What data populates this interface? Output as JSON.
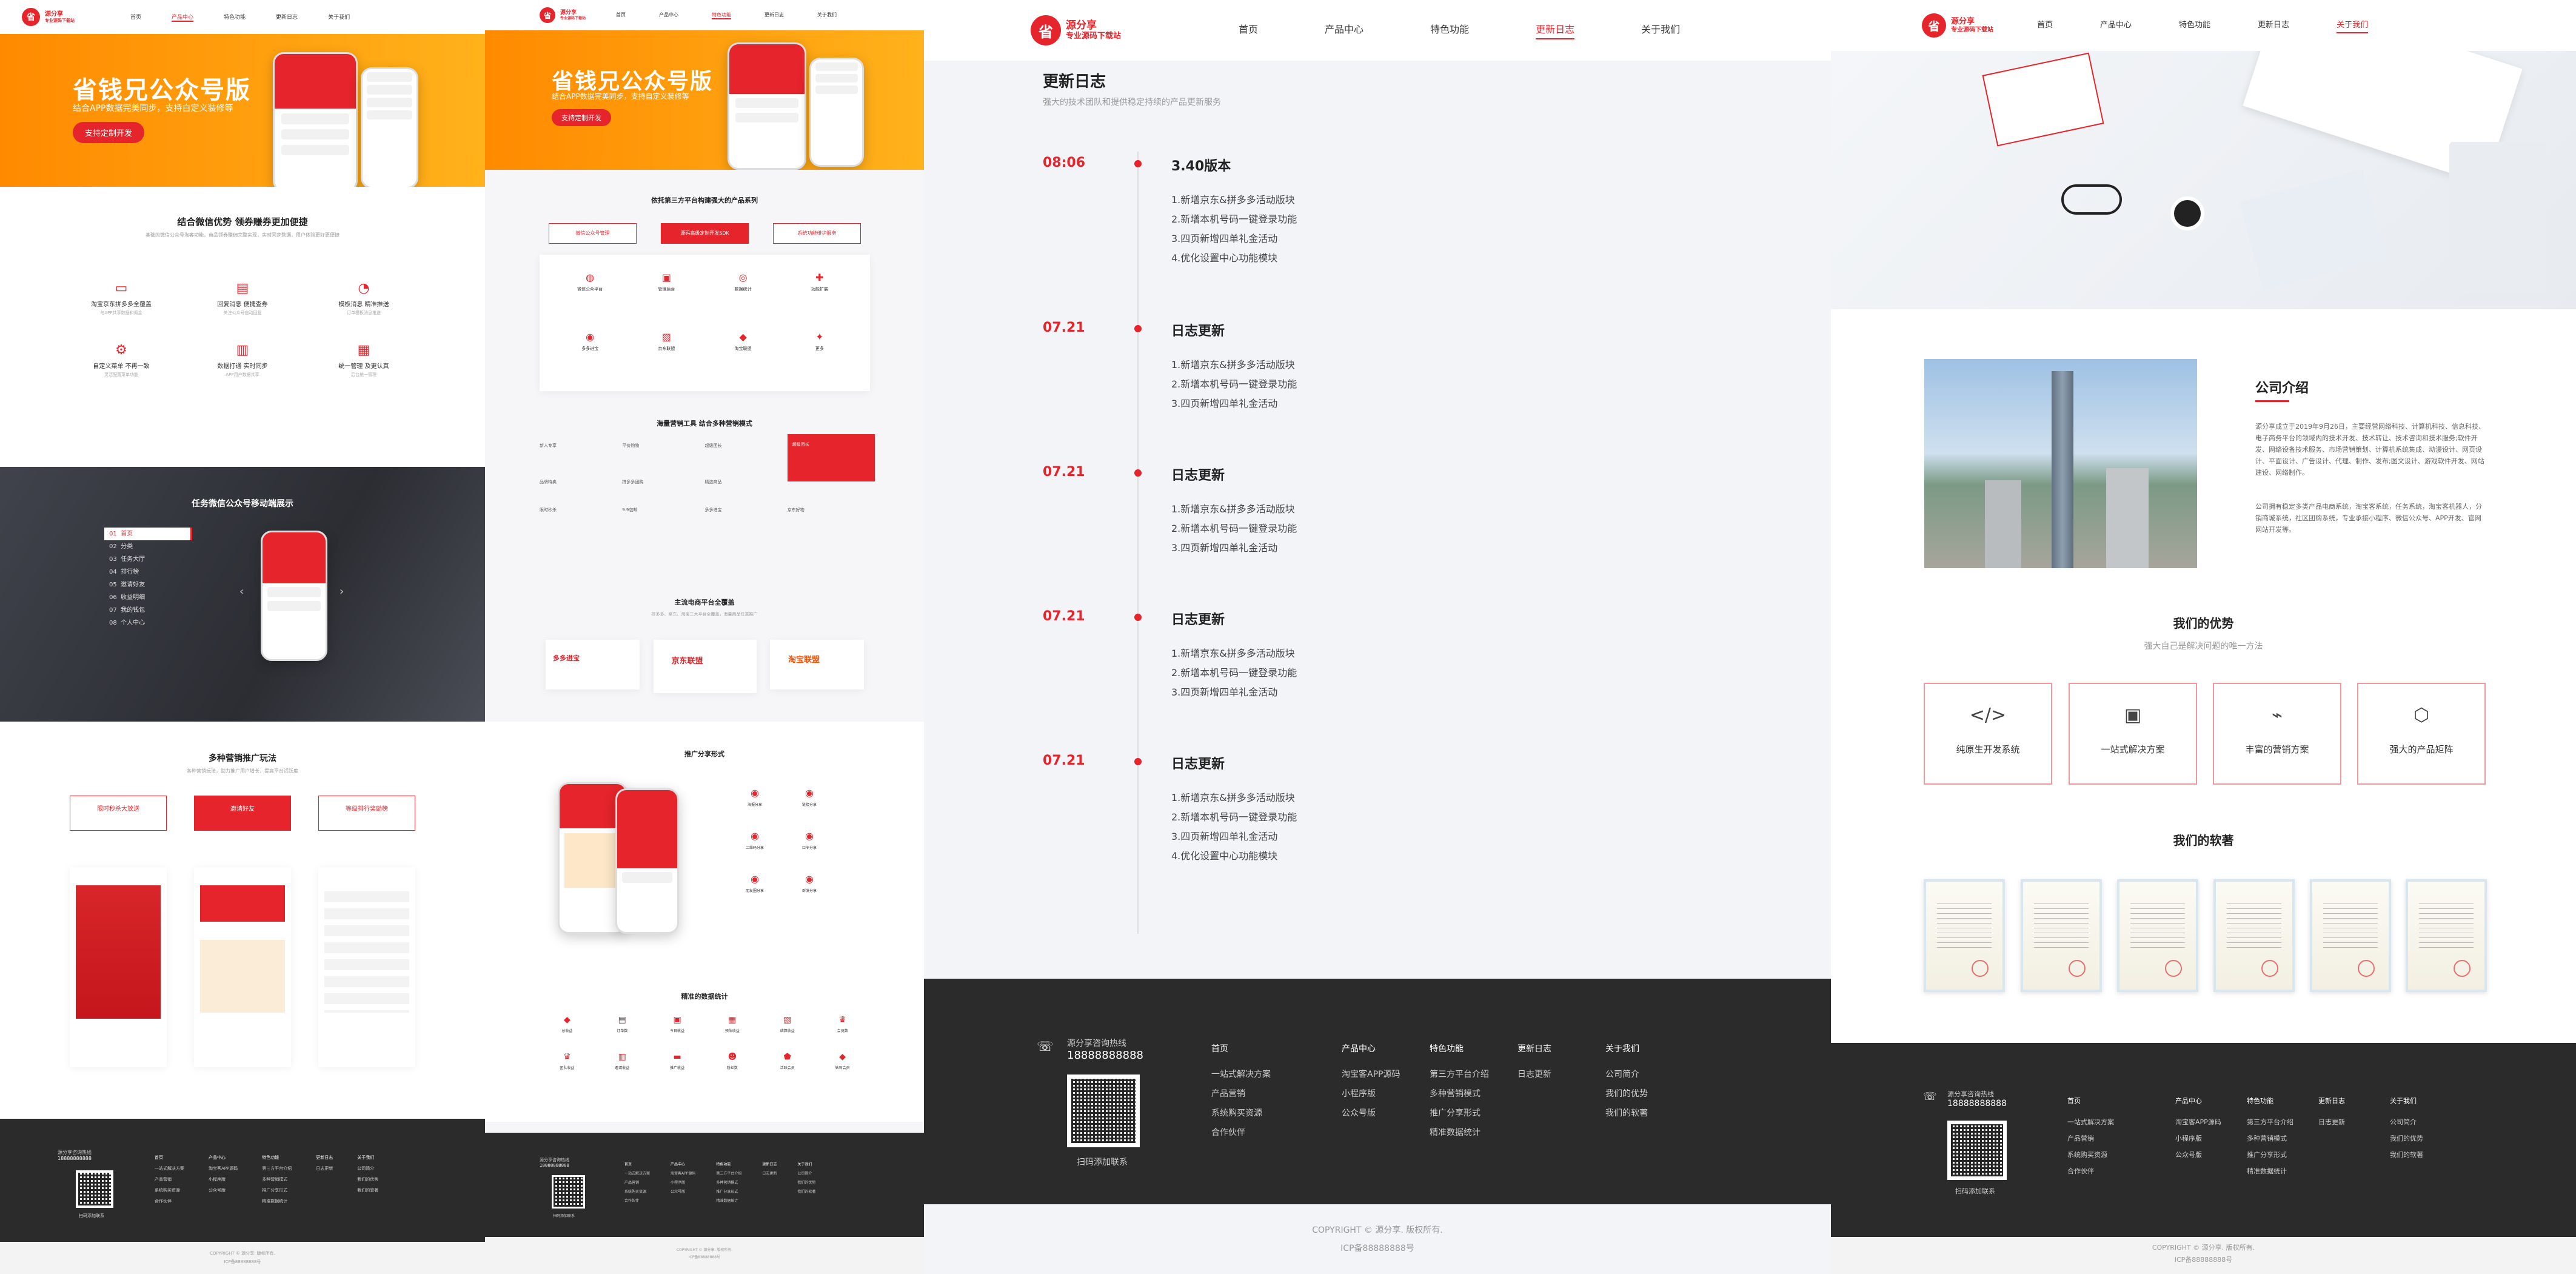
{
  "brand": {
    "mark": "省",
    "name": "源分享",
    "tagline": "专业源码下载站"
  },
  "nav": [
    "首页",
    "产品中心",
    "特色功能",
    "更新日志",
    "关于我们"
  ],
  "p1": {
    "banner": {
      "title": "省钱兄公众号版",
      "sub": "结合APP数据完美同步，支持自定义装修等",
      "btn": "支持定制开发"
    },
    "sec1": {
      "title": "结合微信优势 领券赚券更加便捷",
      "desc": "基础的微信公众号淘客功能，商品领券赚佣完整实现，实时同步数据，用户体验更好更便捷",
      "features": [
        {
          "icon": "▭",
          "t": "淘宝京东拼多多全覆盖",
          "d": "与APP共享数据和佣金"
        },
        {
          "icon": "▤",
          "t": "回复消息 便捷查券",
          "d": "关注公众号自动回复"
        },
        {
          "icon": "◔",
          "t": "模板消息 精准推送",
          "d": "订单模板消息推送"
        },
        {
          "icon": "⚙",
          "t": "自定义菜单 不再一致",
          "d": "灵活配置菜单功能"
        },
        {
          "icon": "▥",
          "t": "数据打通 实时同步",
          "d": "APP用户数据共享"
        },
        {
          "icon": "▦",
          "t": "统一管理 及更认真",
          "d": "后台统一管理"
        }
      ]
    },
    "sec2": {
      "title": "任务微信公众号移动端展示",
      "menu": [
        {
          "n": "01",
          "t": "首页"
        },
        {
          "n": "02",
          "t": "分类"
        },
        {
          "n": "03",
          "t": "任务大厅"
        },
        {
          "n": "04",
          "t": "排行榜"
        },
        {
          "n": "05",
          "t": "邀请好友"
        },
        {
          "n": "06",
          "t": "收益明细"
        },
        {
          "n": "07",
          "t": "我的钱包"
        },
        {
          "n": "08",
          "t": "个人中心"
        }
      ]
    },
    "sec3": {
      "title": "多种营销推广玩法",
      "desc": "各种营销玩法，助力推广用户增长，提高平台活跃度",
      "tabs": [
        "限时秒杀大放送",
        "邀请好友",
        "等级排行奖励榜"
      ]
    },
    "footer": {
      "hotline": "源分享咨询热线",
      "phone": "18888888888",
      "qr": "扫码添加联系",
      "cols": [
        {
          "h": "首页",
          "items": [
            "一站式解决方案",
            "产品营销",
            "系统购买资源",
            "合作伙伴"
          ]
        },
        {
          "h": "产品中心",
          "items": [
            "淘宝客APP源码",
            "小程序版",
            "公众号版"
          ]
        },
        {
          "h": "特色功能",
          "items": [
            "第三方平台介绍",
            "多种营销模式",
            "推广分享形式",
            "精准数据统计"
          ]
        },
        {
          "h": "更新日志",
          "items": [
            "日志更新"
          ]
        },
        {
          "h": "关于我们",
          "items": [
            "公司简介",
            "我们的优势",
            "我们的软著"
          ]
        }
      ]
    },
    "copyright": [
      "COPYRIGHT © 源分享. 版权所有.",
      "ICP备88888888号"
    ]
  },
  "p2": {
    "sec1": {
      "title": "依托第三方平台构建强大的产品系列",
      "tabs": [
        "微信公众号管理",
        "源码高级定制开发SDK",
        "系统功能维护服务"
      ],
      "icons": [
        {
          "icon": "◍",
          "t": "微信公众平台"
        },
        {
          "icon": "▣",
          "t": "管理后台"
        },
        {
          "icon": "◎",
          "t": "数据统计"
        },
        {
          "icon": "✚",
          "t": "功能扩展"
        },
        {
          "icon": "◉",
          "t": "多多进宝"
        },
        {
          "icon": "▧",
          "t": "京东联盟"
        },
        {
          "icon": "◆",
          "t": "淘宝联盟"
        },
        {
          "icon": "✦",
          "t": "更多"
        }
      ]
    },
    "sec2": {
      "title": "海量营销工具 结合多种营销模式",
      "cells": [
        "新人专享",
        "平价购物",
        "超级团长",
        "商品优惠券",
        "品牌特卖",
        "拼多多团购",
        "精选商品",
        "爆款专场",
        "限时秒杀",
        "9.9包邮",
        "多多进宝",
        "京东好物"
      ],
      "highlight": "超级团长"
    },
    "sec3": {
      "title": "主流电商平台全覆盖",
      "desc": "拼多多、京东、淘宝三大平台全覆盖，海量商品任意推广",
      "platforms": [
        {
          "t": "多多进宝",
          "c": "#e5242b"
        },
        {
          "t": "京东联盟",
          "c": "#e5242b"
        },
        {
          "t": "淘宝联盟",
          "c": "#ff5000"
        }
      ]
    },
    "sec4": {
      "title": "推广分享形式",
      "items": [
        "海报分享",
        "链接分享",
        "二维码分享",
        "口令分享",
        "朋友圈分享",
        "群发分享"
      ]
    },
    "sec5": {
      "title": "精准的数据统计",
      "items": [
        "总收益",
        "订单数",
        "今日收益",
        "预估收益",
        "结算收益",
        "会员数",
        "团队收益",
        "邀请收益",
        "推广收益",
        "粉丝数",
        "活跃会员",
        "钻石会员"
      ]
    },
    "footer": {
      "hotline": "源分享咨询热线",
      "phone": "18888888888",
      "qr": "扫码添加联系"
    },
    "copyright": [
      "COPYRIGHT © 源分享. 版权所有.",
      "ICP备88888888号"
    ]
  },
  "p3": {
    "page_title": "更新日志",
    "page_desc": "强大的技术团队和提供稳定持续的产品更新服务",
    "entries": [
      {
        "date": "08:06",
        "title": "3.40版本",
        "items": [
          "1.新增京东&拼多多活动版块",
          "2.新增本机号码一键登录功能",
          "3.四页新增四单礼金活动",
          "4.优化设置中心功能模块"
        ]
      },
      {
        "date": "07.21",
        "title": "日志更新",
        "items": [
          "1.新增京东&拼多多活动版块",
          "2.新增本机号码一键登录功能",
          "3.四页新增四单礼金活动"
        ]
      },
      {
        "date": "07.21",
        "title": "日志更新",
        "items": [
          "1.新增京东&拼多多活动版块",
          "2.新增本机号码一键登录功能",
          "3.四页新增四单礼金活动"
        ]
      },
      {
        "date": "07.21",
        "title": "日志更新",
        "items": [
          "1.新增京东&拼多多活动版块",
          "2.新增本机号码一键登录功能",
          "3.四页新增四单礼金活动"
        ]
      },
      {
        "date": "07.21",
        "title": "日志更新",
        "items": [
          "1.新增京东&拼多多活动版块",
          "2.新增本机号码一键登录功能",
          "3.四页新增四单礼金活动",
          "4.优化设置中心功能模块"
        ]
      }
    ],
    "footer": {
      "hotline": "源分享咨询热线",
      "phone": "18888888888",
      "qr": "扫码添加联系",
      "cols": [
        {
          "h": "首页",
          "items": [
            "一站式解决方案",
            "产品营销",
            "系统购买资源",
            "合作伙伴"
          ]
        },
        {
          "h": "产品中心",
          "items": [
            "淘宝客APP源码",
            "小程序版",
            "公众号版"
          ]
        },
        {
          "h": "特色功能",
          "items": [
            "第三方平台介绍",
            "多种营销模式",
            "推广分享形式",
            "精准数据统计"
          ]
        },
        {
          "h": "更新日志",
          "items": [
            "日志更新"
          ]
        },
        {
          "h": "关于我们",
          "items": [
            "公司简介",
            "我们的优势",
            "我们的软著"
          ]
        }
      ]
    },
    "copyright": [
      "COPYRIGHT © 源分享. 版权所有.",
      "ICP备88888888号"
    ]
  },
  "p4": {
    "intro_title": "公司介绍",
    "intro_p1": "源分享成立于2019年9月26日，主要经营网络科技、计算机科技、信息科技、电子商务平台的领域内的技术开发、技术转让、技术咨询和技术服务;软件开发、网络设备技术服务、市场营销策划、计算机系统集成、动漫设计、网页设计、平面设计、广告设计、代理、制作、发布;图文设计、游戏软件开发、网站建设、网络制作。",
    "intro_p2": "公司拥有稳定多类产品电商系统，淘宝客系统，任务系统，淘宝客机器人，分销商城系统，社区团购系统，专业承接小程序、微信公众号、APP开发、官网网站开发等。",
    "adv_title": "我们的优势",
    "adv_desc": "强大自己是解决问题的唯一方法",
    "adv": [
      {
        "icon": "</>",
        "t": "纯原生开发系统"
      },
      {
        "icon": "▣",
        "t": "一站式解决方案"
      },
      {
        "icon": "⌁",
        "t": "丰富的营销方案"
      },
      {
        "icon": "⬡",
        "t": "强大的产品矩阵"
      }
    ],
    "soft_title": "我们的软著",
    "footer": {
      "hotline": "源分享咨询热线",
      "phone": "18888888888",
      "qr": "扫码添加联系",
      "cols": [
        {
          "h": "首页",
          "items": [
            "一站式解决方案",
            "产品营销",
            "系统购买资源",
            "合作伙伴"
          ]
        },
        {
          "h": "产品中心",
          "items": [
            "淘宝客APP源码",
            "小程序版",
            "公众号版"
          ]
        },
        {
          "h": "特色功能",
          "items": [
            "第三方平台介绍",
            "多种营销模式",
            "推广分享形式",
            "精准数据统计"
          ]
        },
        {
          "h": "更新日志",
          "items": [
            "日志更新"
          ]
        },
        {
          "h": "关于我们",
          "items": [
            "公司简介",
            "我们的优势",
            "我们的软著"
          ]
        }
      ]
    },
    "copyright": [
      "COPYRIGHT © 源分享. 版权所有.",
      "ICP备88888888号"
    ]
  },
  "colors": {
    "accent": "#e5242b",
    "orange": "#ff9a0e",
    "footer": "#2b2b2b"
  }
}
